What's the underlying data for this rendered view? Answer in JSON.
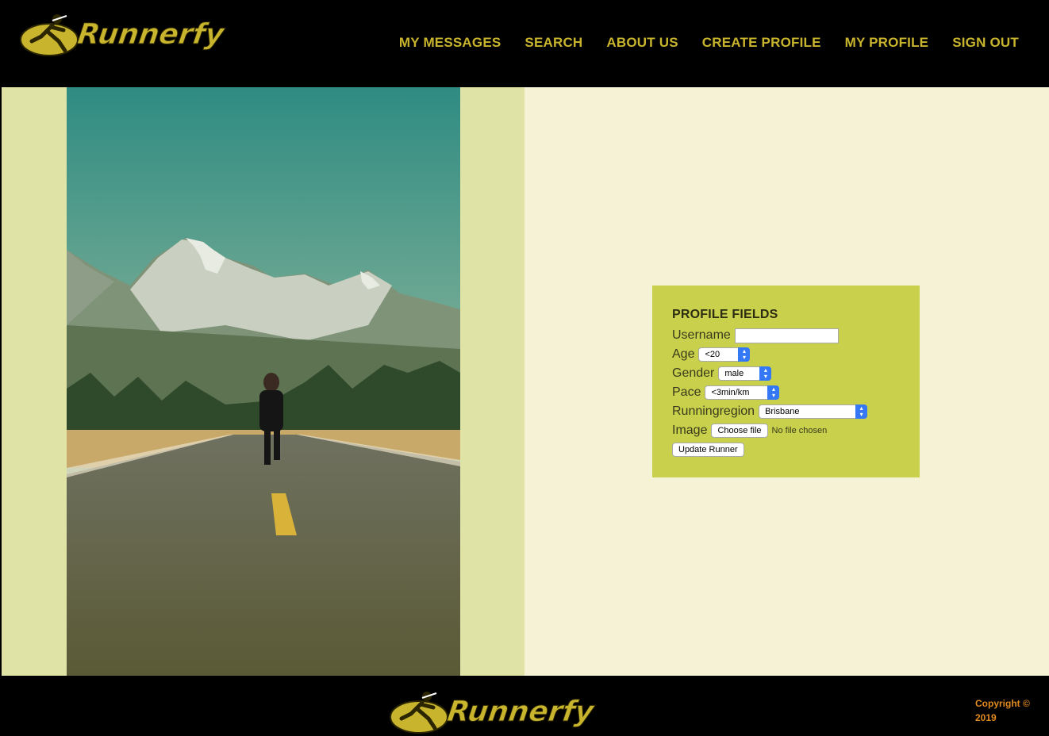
{
  "header": {
    "logo_text": "Runnerfy",
    "nav": [
      "MY MESSAGES",
      "SEARCH",
      "ABOUT US",
      "CREATE PROFILE",
      "MY PROFILE",
      "SIGN OUT"
    ]
  },
  "form": {
    "title": "PROFILE FIELDS",
    "username_label": "Username",
    "username_value": "",
    "age_label": "Age",
    "age_value": "<20",
    "gender_label": "Gender",
    "gender_value": "male",
    "pace_label": "Pace",
    "pace_value": "<3min/km",
    "region_label": "Runningregion",
    "region_value": "Brisbane",
    "image_label": "Image",
    "choose_file_label": "Choose file",
    "no_file_text": "No file chosen",
    "submit_label": "Update Runner"
  },
  "footer": {
    "logo_text": "Runnerfy",
    "copyright_line1": "Copyright ©",
    "copyright_line2": "2019"
  },
  "colors": {
    "brand_gold": "#c9b52d",
    "left_panel": "#dfe4a6",
    "page_bg": "#f5f2d6",
    "form_bg": "#c8d04c",
    "copyright": "#e08a1e",
    "select_arrow": "#3478f6"
  },
  "icons": {
    "logo": "runner-logo-icon",
    "select": "chevron-updown-icon"
  }
}
